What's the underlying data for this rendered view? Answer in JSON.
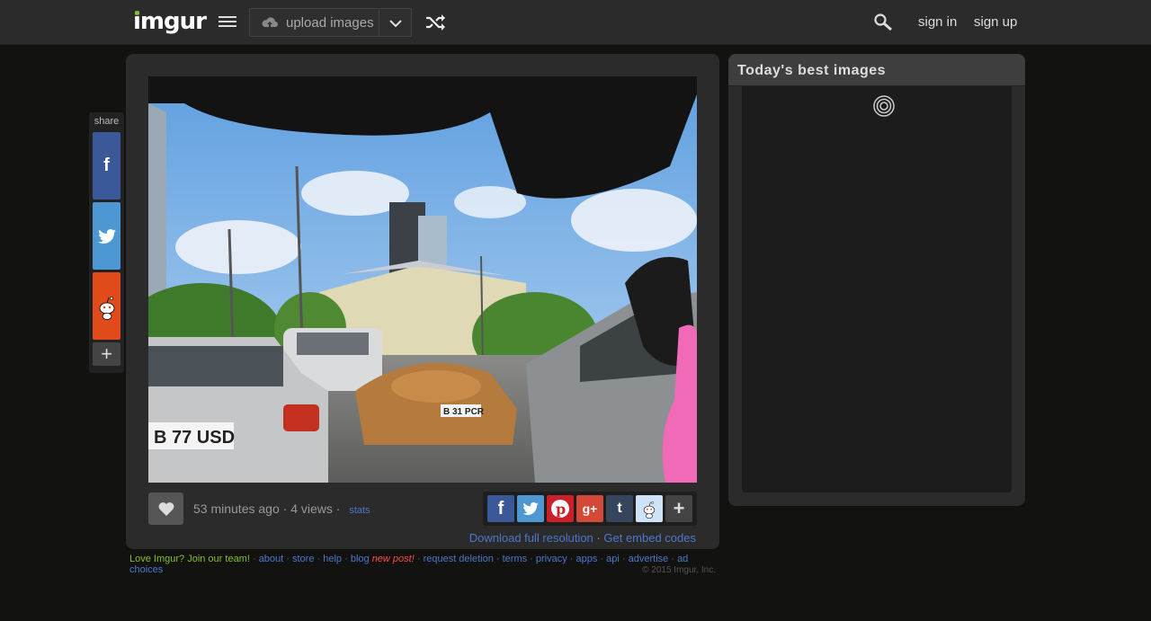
{
  "header": {
    "logo": "imgur",
    "upload_label": "upload images",
    "sign_in": "sign in",
    "sign_up": "sign up",
    "icons": [
      "menu-icon",
      "cloud-upload-icon",
      "chevron-down-icon",
      "shuffle-icon",
      "search-icon"
    ]
  },
  "share_sidebar": {
    "label": "share",
    "items": [
      {
        "name": "facebook",
        "color": "#3b5998"
      },
      {
        "name": "twitter",
        "color": "#4d98d3"
      },
      {
        "name": "reddit",
        "color": "#e14a1b"
      }
    ],
    "more": "+"
  },
  "image_panel": {
    "time_ago": "53 minutes ago",
    "views": "4 views",
    "separator": "·",
    "stats": "stats",
    "download_link": "Download full resolution",
    "embed_link": "Get embed codes",
    "social": [
      "facebook",
      "twitter",
      "pinterest",
      "google-plus",
      "tumblr",
      "reddit",
      "more"
    ]
  },
  "footer": {
    "join": "Love Imgur? Join our team!",
    "links": [
      "about",
      "store",
      "help",
      "blog"
    ],
    "new_post": "new post!",
    "links2": [
      "request deletion",
      "terms",
      "privacy",
      "apps",
      "api",
      "advertise",
      "ad choices"
    ],
    "copyright": "© 2015 Imgur, Inc."
  },
  "sidebar": {
    "title": "Today's best images"
  },
  "colors": {
    "accent_green": "#85bf25",
    "link_blue": "#4e76c9",
    "background": "#121211",
    "panel": "#2b2b2b"
  }
}
